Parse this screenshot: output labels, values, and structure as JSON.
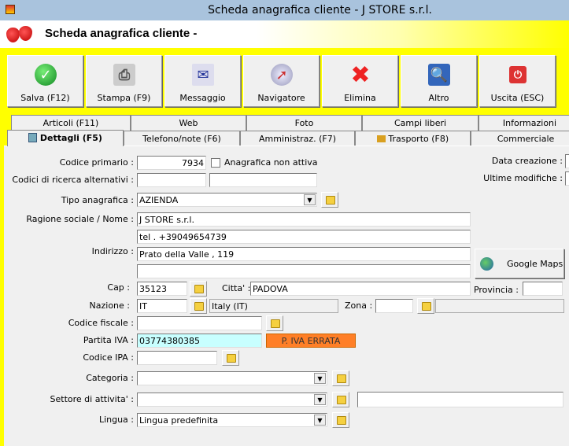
{
  "window": {
    "title": "Scheda anagrafica cliente - J STORE s.r.l."
  },
  "header": {
    "title": "Scheda anagrafica cliente -"
  },
  "toolbar": [
    {
      "label": "Salva (F12)",
      "icon": "check-icon"
    },
    {
      "label": "Stampa (F9)",
      "icon": "printer-icon"
    },
    {
      "label": "Messaggio",
      "icon": "mail-icon"
    },
    {
      "label": "Navigatore",
      "icon": "compass-icon"
    },
    {
      "label": "Elimina",
      "icon": "delete-x-icon"
    },
    {
      "label": "Altro",
      "icon": "search-book-icon"
    },
    {
      "label": "Uscita (ESC)",
      "icon": "power-icon"
    }
  ],
  "tabs_row1": [
    "Articoli (F11)",
    "Web",
    "Foto",
    "Campi liberi",
    "Informazioni"
  ],
  "tabs_row2": [
    "Dettagli (F5)",
    "Telefono/note (F6)",
    "Amministraz. (F7)",
    "Trasporto (F8)",
    "Commerciale"
  ],
  "form": {
    "codice_primario_label": "Codice primario :",
    "codice_primario": "7934",
    "non_attiva_label": "Anagrafica non attiva",
    "data_creazione_label": "Data creazione :",
    "ultime_modifiche_label": "Ultime modifiche :",
    "codici_alt_label": "Codici di ricerca alternativi :",
    "tipo_label": "Tipo anagrafica :",
    "tipo": "AZIENDA",
    "ragione_label": "Ragione sociale / Nome :",
    "ragione": "J STORE s.r.l.",
    "ragione2": "tel . +39049654739",
    "indirizzo_label": "Indirizzo :",
    "indirizzo": "Prato della Valle , 119",
    "google_maps": "Google Maps",
    "cap_label": "Cap :",
    "cap": "35123",
    "citta_label": "Citta' :",
    "citta": "PADOVA",
    "provincia_label": "Provincia :",
    "nazione_label": "Nazione :",
    "nazione": "IT",
    "nazione_desc": "Italy (IT)",
    "zona_label": "Zona :",
    "cf_label": "Codice fiscale :",
    "piva_label": "Partita IVA :",
    "piva": "03774380385",
    "piva_error": "P. IVA ERRATA",
    "ipa_label": "Codice IPA :",
    "categoria_label": "Categoria :",
    "settore_label": "Settore di attivita' :",
    "lingua_label": "Lingua :",
    "lingua": "Lingua predefinita"
  },
  "colors": {
    "accent": "#ffff00",
    "error": "#ff7f27",
    "piva_bg": "#c8ffff"
  }
}
